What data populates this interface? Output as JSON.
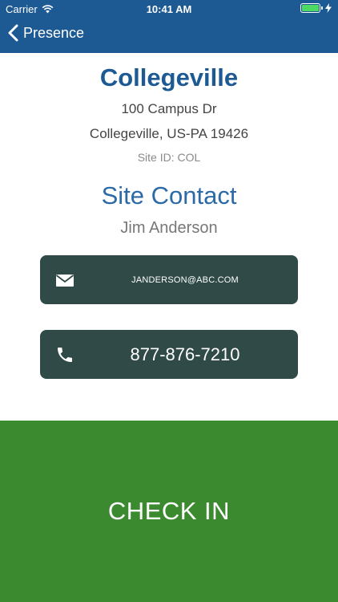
{
  "status_bar": {
    "carrier": "Carrier",
    "time": "10:41 AM"
  },
  "nav": {
    "back_label": "Presence"
  },
  "site": {
    "name": "Collegeville",
    "address_line1": "100 Campus Dr",
    "address_line2": "Collegeville, US-PA 19426",
    "site_id": "Site ID: COL"
  },
  "contact": {
    "heading": "Site Contact",
    "name": "Jim Anderson",
    "email": "JANDERSON@ABC.COM",
    "phone": "877-876-7210"
  },
  "checkin": {
    "label": "CHECK IN"
  },
  "colors": {
    "header_blue": "#1d5a94",
    "button_dark": "#2f4a47",
    "checkin_green": "#3b8a2f"
  },
  "icons": [
    "wifi-icon",
    "battery-icon",
    "charging-icon",
    "back-chevron-icon",
    "envelope-icon",
    "phone-icon"
  ]
}
